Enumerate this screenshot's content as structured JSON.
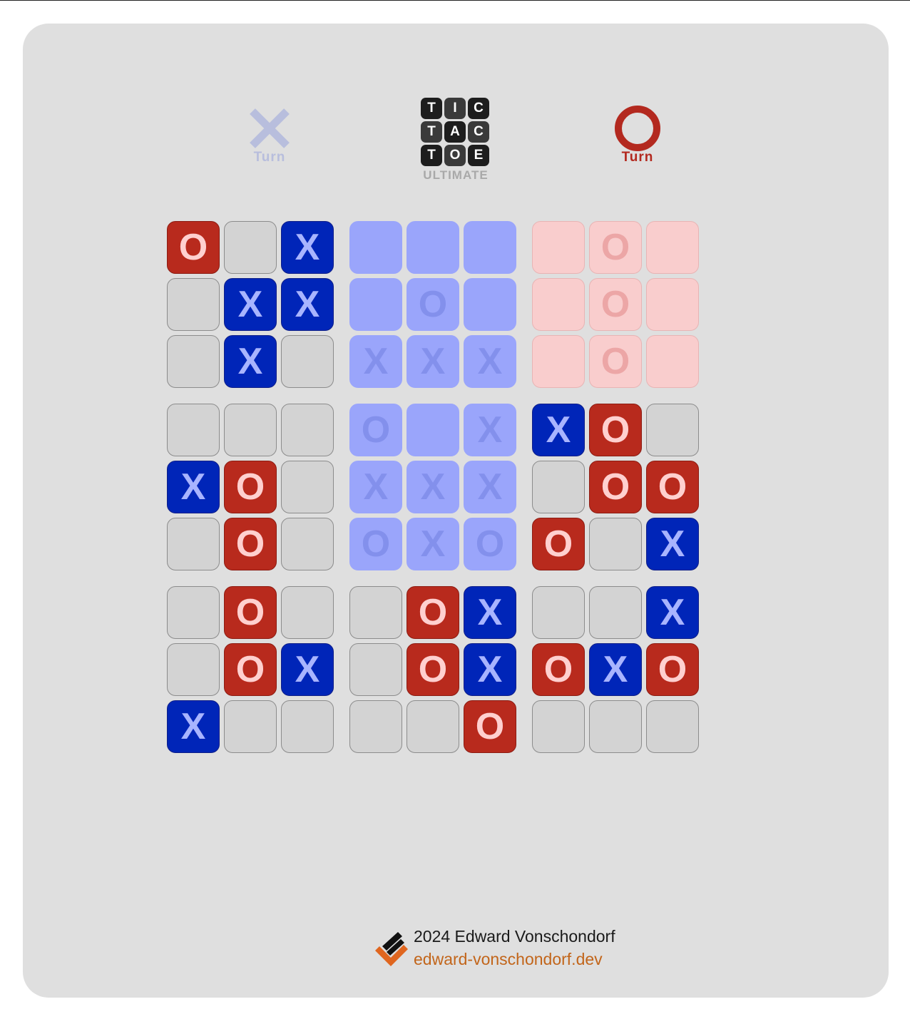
{
  "header": {
    "x_turn_label": "Turn",
    "o_turn_label": "Turn",
    "logo_letters": [
      "T",
      "I",
      "C",
      "T",
      "A",
      "C",
      "T",
      "O",
      "E"
    ],
    "logo_subtitle": "ULTIMATE"
  },
  "active_player": "O",
  "board": [
    {
      "winner": null,
      "cells": [
        "O",
        "",
        "X",
        "",
        "X",
        "X",
        "",
        "X",
        ""
      ]
    },
    {
      "winner": "X",
      "cells": [
        "",
        "",
        "",
        "",
        "O",
        "",
        "X",
        "X",
        "X"
      ]
    },
    {
      "winner": "O",
      "cells": [
        "",
        "O",
        "",
        "",
        "O",
        "",
        "",
        "O",
        ""
      ]
    },
    {
      "winner": null,
      "cells": [
        "",
        "",
        "",
        "X",
        "O",
        "",
        "",
        "O",
        ""
      ]
    },
    {
      "winner": "X",
      "cells": [
        "O",
        "",
        "X",
        "X",
        "X",
        "X",
        "O",
        "X",
        "O"
      ]
    },
    {
      "winner": null,
      "cells": [
        "X",
        "O",
        "",
        "",
        "O",
        "O",
        "O",
        "",
        "X"
      ]
    },
    {
      "winner": null,
      "cells": [
        "",
        "O",
        "",
        "",
        "O",
        "X",
        "X",
        "",
        ""
      ]
    },
    {
      "winner": null,
      "cells": [
        "",
        "O",
        "X",
        "",
        "O",
        "X",
        "",
        "",
        "O"
      ]
    },
    {
      "winner": null,
      "cells": [
        "",
        "",
        "X",
        "O",
        "X",
        "O",
        "",
        "",
        ""
      ]
    }
  ],
  "colors": {
    "x": "#0025b8",
    "o": "#b82a1d",
    "x_inactive": "#b8bedd",
    "link": "#c2651a"
  },
  "footer": {
    "copyright": "2024 Edward Vonschondorf",
    "link": "edward-vonschondorf.dev"
  }
}
